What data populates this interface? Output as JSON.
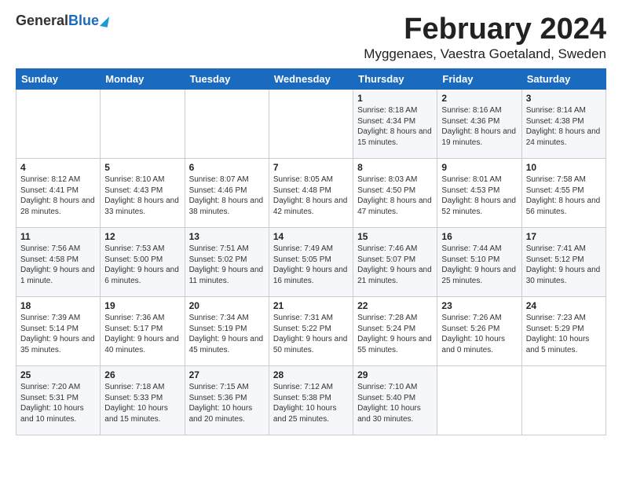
{
  "header": {
    "logo_general": "General",
    "logo_blue": "Blue",
    "month_year": "February 2024",
    "location": "Myggenaes, Vaestra Goetaland, Sweden"
  },
  "days_of_week": [
    "Sunday",
    "Monday",
    "Tuesday",
    "Wednesday",
    "Thursday",
    "Friday",
    "Saturday"
  ],
  "weeks": [
    [
      {
        "day": "",
        "info": ""
      },
      {
        "day": "",
        "info": ""
      },
      {
        "day": "",
        "info": ""
      },
      {
        "day": "",
        "info": ""
      },
      {
        "day": "1",
        "info": "Sunrise: 8:18 AM\nSunset: 4:34 PM\nDaylight: 8 hours and 15 minutes."
      },
      {
        "day": "2",
        "info": "Sunrise: 8:16 AM\nSunset: 4:36 PM\nDaylight: 8 hours and 19 minutes."
      },
      {
        "day": "3",
        "info": "Sunrise: 8:14 AM\nSunset: 4:38 PM\nDaylight: 8 hours and 24 minutes."
      }
    ],
    [
      {
        "day": "4",
        "info": "Sunrise: 8:12 AM\nSunset: 4:41 PM\nDaylight: 8 hours and 28 minutes."
      },
      {
        "day": "5",
        "info": "Sunrise: 8:10 AM\nSunset: 4:43 PM\nDaylight: 8 hours and 33 minutes."
      },
      {
        "day": "6",
        "info": "Sunrise: 8:07 AM\nSunset: 4:46 PM\nDaylight: 8 hours and 38 minutes."
      },
      {
        "day": "7",
        "info": "Sunrise: 8:05 AM\nSunset: 4:48 PM\nDaylight: 8 hours and 42 minutes."
      },
      {
        "day": "8",
        "info": "Sunrise: 8:03 AM\nSunset: 4:50 PM\nDaylight: 8 hours and 47 minutes."
      },
      {
        "day": "9",
        "info": "Sunrise: 8:01 AM\nSunset: 4:53 PM\nDaylight: 8 hours and 52 minutes."
      },
      {
        "day": "10",
        "info": "Sunrise: 7:58 AM\nSunset: 4:55 PM\nDaylight: 8 hours and 56 minutes."
      }
    ],
    [
      {
        "day": "11",
        "info": "Sunrise: 7:56 AM\nSunset: 4:58 PM\nDaylight: 9 hours and 1 minute."
      },
      {
        "day": "12",
        "info": "Sunrise: 7:53 AM\nSunset: 5:00 PM\nDaylight: 9 hours and 6 minutes."
      },
      {
        "day": "13",
        "info": "Sunrise: 7:51 AM\nSunset: 5:02 PM\nDaylight: 9 hours and 11 minutes."
      },
      {
        "day": "14",
        "info": "Sunrise: 7:49 AM\nSunset: 5:05 PM\nDaylight: 9 hours and 16 minutes."
      },
      {
        "day": "15",
        "info": "Sunrise: 7:46 AM\nSunset: 5:07 PM\nDaylight: 9 hours and 21 minutes."
      },
      {
        "day": "16",
        "info": "Sunrise: 7:44 AM\nSunset: 5:10 PM\nDaylight: 9 hours and 25 minutes."
      },
      {
        "day": "17",
        "info": "Sunrise: 7:41 AM\nSunset: 5:12 PM\nDaylight: 9 hours and 30 minutes."
      }
    ],
    [
      {
        "day": "18",
        "info": "Sunrise: 7:39 AM\nSunset: 5:14 PM\nDaylight: 9 hours and 35 minutes."
      },
      {
        "day": "19",
        "info": "Sunrise: 7:36 AM\nSunset: 5:17 PM\nDaylight: 9 hours and 40 minutes."
      },
      {
        "day": "20",
        "info": "Sunrise: 7:34 AM\nSunset: 5:19 PM\nDaylight: 9 hours and 45 minutes."
      },
      {
        "day": "21",
        "info": "Sunrise: 7:31 AM\nSunset: 5:22 PM\nDaylight: 9 hours and 50 minutes."
      },
      {
        "day": "22",
        "info": "Sunrise: 7:28 AM\nSunset: 5:24 PM\nDaylight: 9 hours and 55 minutes."
      },
      {
        "day": "23",
        "info": "Sunrise: 7:26 AM\nSunset: 5:26 PM\nDaylight: 10 hours and 0 minutes."
      },
      {
        "day": "24",
        "info": "Sunrise: 7:23 AM\nSunset: 5:29 PM\nDaylight: 10 hours and 5 minutes."
      }
    ],
    [
      {
        "day": "25",
        "info": "Sunrise: 7:20 AM\nSunset: 5:31 PM\nDaylight: 10 hours and 10 minutes."
      },
      {
        "day": "26",
        "info": "Sunrise: 7:18 AM\nSunset: 5:33 PM\nDaylight: 10 hours and 15 minutes."
      },
      {
        "day": "27",
        "info": "Sunrise: 7:15 AM\nSunset: 5:36 PM\nDaylight: 10 hours and 20 minutes."
      },
      {
        "day": "28",
        "info": "Sunrise: 7:12 AM\nSunset: 5:38 PM\nDaylight: 10 hours and 25 minutes."
      },
      {
        "day": "29",
        "info": "Sunrise: 7:10 AM\nSunset: 5:40 PM\nDaylight: 10 hours and 30 minutes."
      },
      {
        "day": "",
        "info": ""
      },
      {
        "day": "",
        "info": ""
      }
    ]
  ]
}
